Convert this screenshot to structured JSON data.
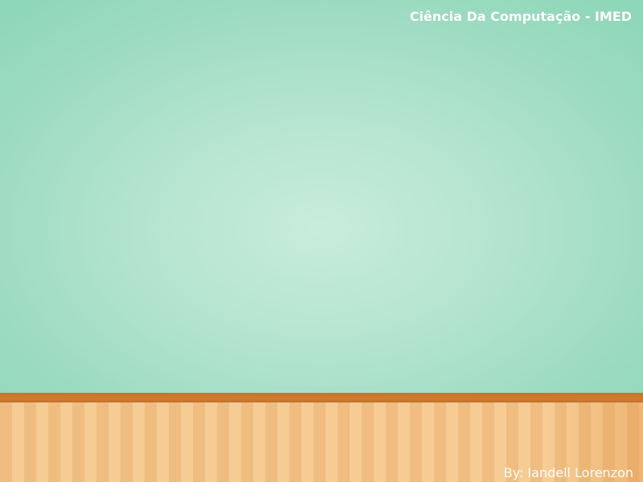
{
  "slide": {
    "header_title": "Ciência Da Computação - IMED",
    "author": "By: Iandell Lorenzon"
  },
  "colors": {
    "wall_center": "#c8ecdc",
    "wall_edge": "#8fd7b9",
    "rail": "#c7732a",
    "stripe_light": "#f5cc94",
    "stripe_dark": "#efbd80",
    "text": "#ffffff"
  }
}
